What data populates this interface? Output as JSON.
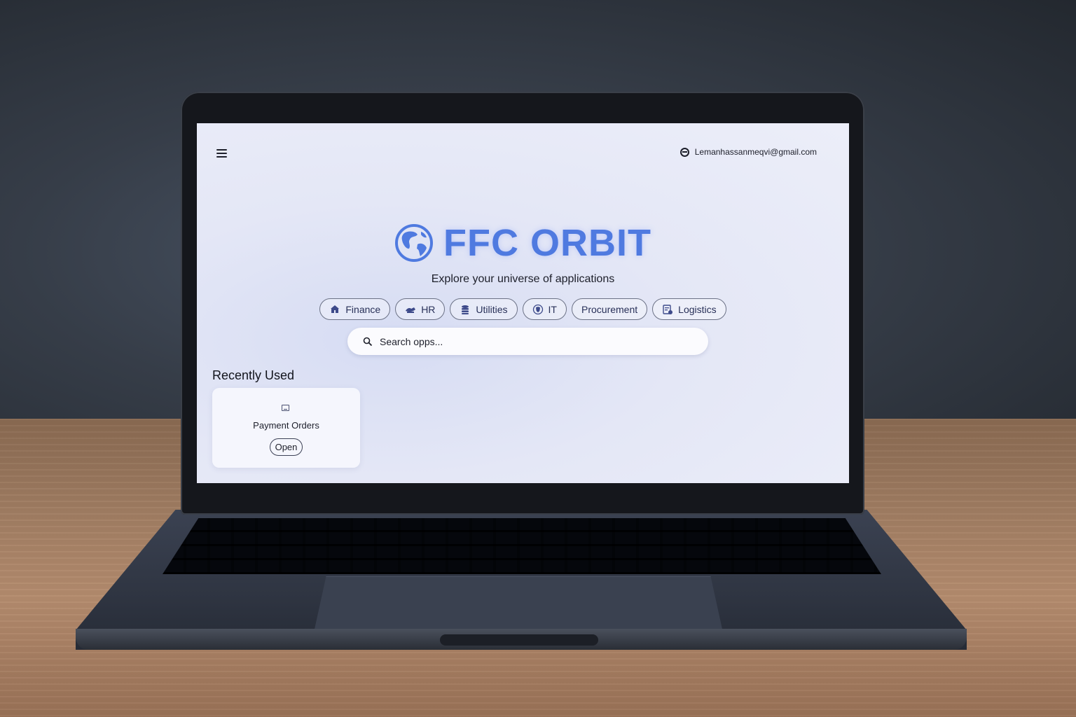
{
  "header": {
    "account_email": "Lemanhassanmeqvi@gmail.com"
  },
  "brand": {
    "title": "FFC ORBIT",
    "logo_icon": "globe-icon",
    "accent_color": "#4f7ae0"
  },
  "tagline": "Explore your universe of applications",
  "categories": [
    {
      "label": "Finance",
      "icon": "bank-icon"
    },
    {
      "label": "HR",
      "icon": "people-icon"
    },
    {
      "label": "Utilities",
      "icon": "stack-icon"
    },
    {
      "label": "IT",
      "icon": "shield-icon"
    },
    {
      "label": "Procurement",
      "icon": ""
    },
    {
      "label": "Logistics",
      "icon": "clipboard-icon"
    }
  ],
  "search": {
    "placeholder": "Search opps...",
    "icon": "search-icon"
  },
  "recent": {
    "title": "Recently Used",
    "items": [
      {
        "name": "Payment Orders",
        "action_label": "Open",
        "icon": "monitor-icon"
      }
    ]
  }
}
